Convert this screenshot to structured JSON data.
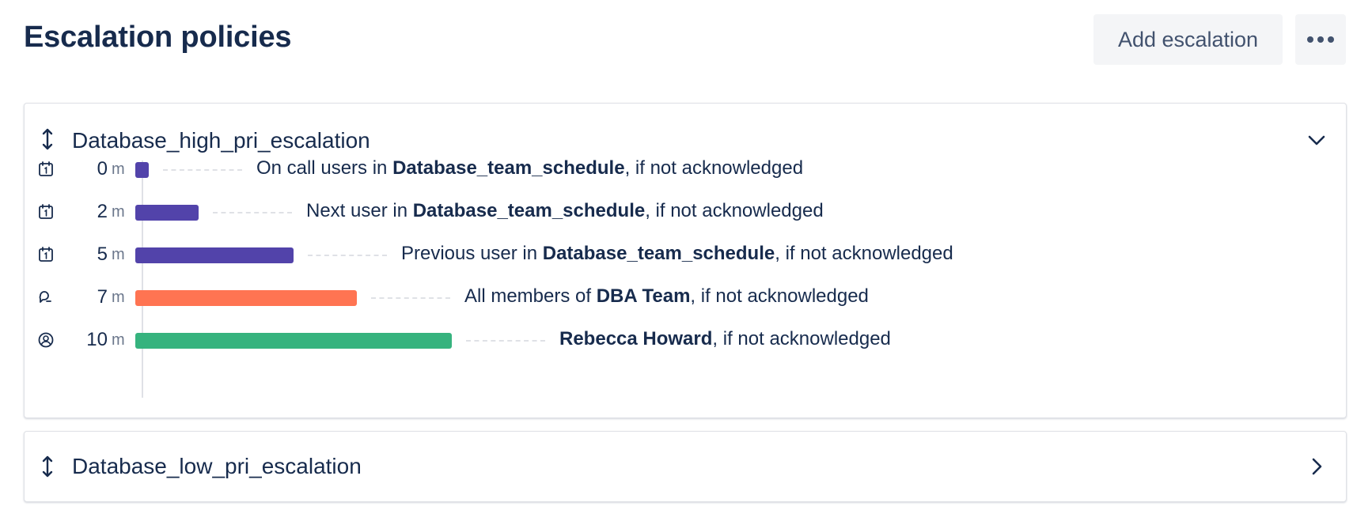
{
  "header": {
    "title": "Escalation policies",
    "add_label": "Add escalation",
    "more_icon": "more-icon"
  },
  "colors": {
    "schedule": "#5243aa",
    "team": "#ff7452",
    "user": "#36b37e",
    "text": "#172b4d",
    "muted": "#6b778c"
  },
  "policies": [
    {
      "name": "Database_high_pri_escalation",
      "expanded": true,
      "steps": [
        {
          "icon": "calendar-icon",
          "delay": "0",
          "unit": "m",
          "minutes": 0,
          "color": "#5243aa",
          "prefix": "On call users in ",
          "target": "Database_team_schedule",
          "suffix": ", if not acknowledged"
        },
        {
          "icon": "calendar-icon",
          "delay": "2",
          "unit": "m",
          "minutes": 2,
          "color": "#5243aa",
          "prefix": "Next user in ",
          "target": "Database_team_schedule",
          "suffix": ", if not acknowledged"
        },
        {
          "icon": "calendar-icon",
          "delay": "5",
          "unit": "m",
          "minutes": 5,
          "color": "#5243aa",
          "prefix": "Previous user in ",
          "target": "Database_team_schedule",
          "suffix": ", if not acknowledged"
        },
        {
          "icon": "team-icon",
          "delay": "7",
          "unit": "m",
          "minutes": 7,
          "color": "#ff7452",
          "prefix": "All members of ",
          "target": "DBA Team",
          "suffix": ", if not acknowledged"
        },
        {
          "icon": "user-icon",
          "delay": "10",
          "unit": "m",
          "minutes": 10,
          "color": "#36b37e",
          "prefix": "",
          "target": "Rebecca Howard",
          "suffix": ", if not acknowledged"
        }
      ]
    },
    {
      "name": "Database_low_pri_escalation",
      "expanded": false,
      "steps": []
    }
  ]
}
